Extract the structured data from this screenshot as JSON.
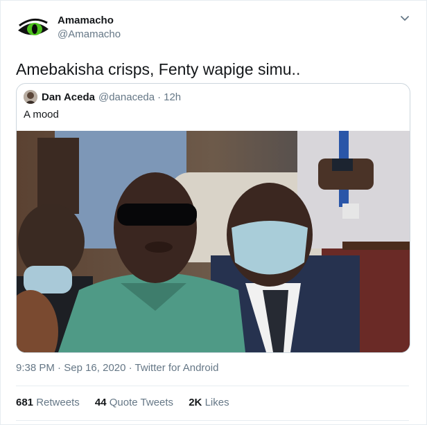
{
  "author": {
    "name": "Amamacho",
    "handle": "@Amamacho"
  },
  "tweet_text": "Amebakisha crisps, Fenty wapige simu..",
  "quoted": {
    "name": "Dan Aceda",
    "handle": "@danaceda",
    "separator": "·",
    "time": "12h",
    "text": "A mood"
  },
  "meta": {
    "time": "9:38 PM",
    "sep1": "·",
    "date": "Sep 16, 2020",
    "sep2": "·",
    "source": "Twitter for Android"
  },
  "stats": {
    "retweets_count": "681",
    "retweets_label": "Retweets",
    "quotes_count": "44",
    "quotes_label": "Quote Tweets",
    "likes_count": "2K",
    "likes_label": "Likes"
  },
  "icons": {
    "caret": "chevron-down-icon",
    "avatar": "green-eye-avatar"
  }
}
